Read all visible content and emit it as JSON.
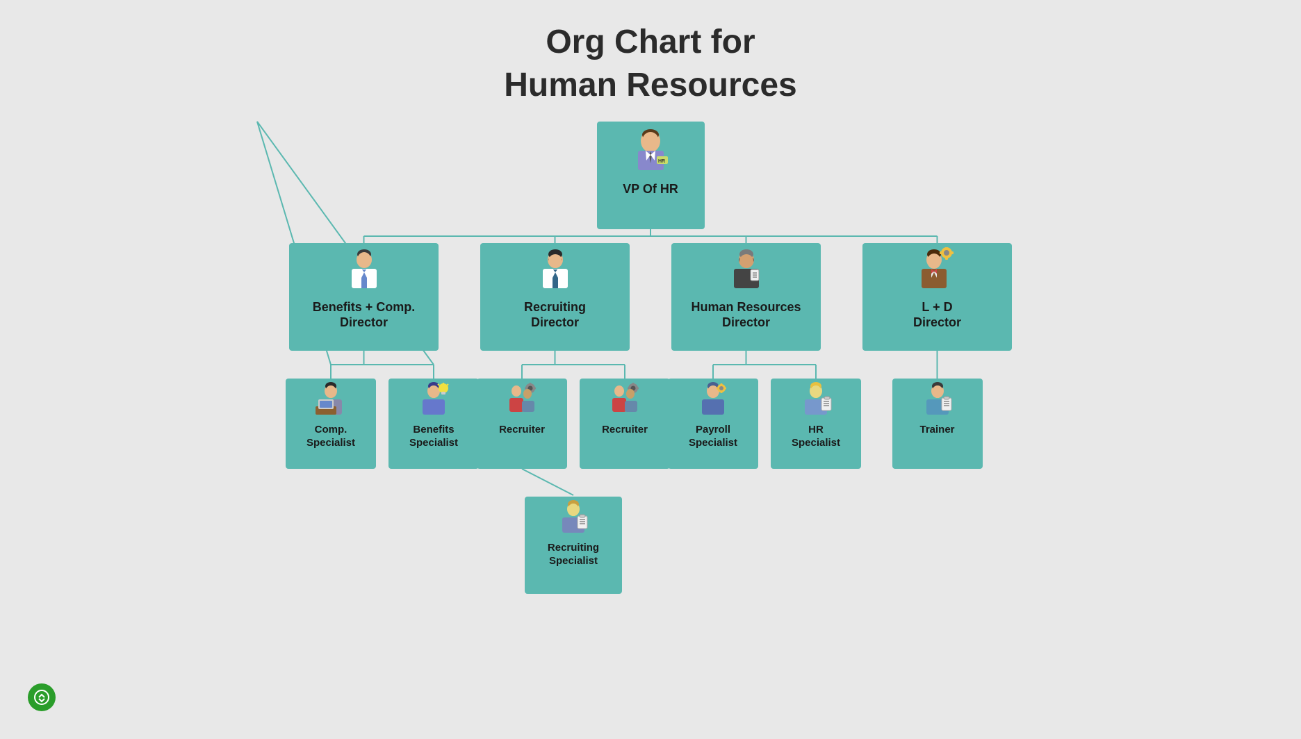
{
  "title": {
    "line1": "Org Chart for",
    "line2": "Human Resources"
  },
  "nodes": {
    "vp": {
      "label": "VP Of HR",
      "icon": "👨‍💼"
    },
    "directors": [
      {
        "id": "benefits-comp",
        "label": "Benefits + Comp.\nDirector",
        "icon": "👨‍💼"
      },
      {
        "id": "recruiting",
        "label": "Recruiting\nDirector",
        "icon": "👨‍💼"
      },
      {
        "id": "hr-director",
        "label": "Human Resources\nDirector",
        "icon": "👨‍💼"
      },
      {
        "id": "ld-director",
        "label": "L + D\nDirector",
        "icon": "👨‍💼"
      }
    ],
    "specialists": {
      "benefits-comp": [
        {
          "id": "comp-specialist",
          "label": "Comp.\nSpecialist",
          "icon": "🧑‍💻"
        },
        {
          "id": "benefits-specialist",
          "label": "Benefits\nSpecialist",
          "icon": "👨‍💼"
        }
      ],
      "recruiting": [
        {
          "id": "recruiter1",
          "label": "Recruiter",
          "icon": "👥"
        },
        {
          "id": "recruiter2",
          "label": "Recruiter",
          "icon": "👥"
        }
      ],
      "hr-director": [
        {
          "id": "payroll-specialist",
          "label": "Payroll\nSpecialist",
          "icon": "🧑‍💼"
        },
        {
          "id": "hr-specialist",
          "label": "HR\nSpecialist",
          "icon": "🧑‍💼"
        }
      ],
      "ld-director": [
        {
          "id": "trainer",
          "label": "Trainer",
          "icon": "🧑‍🏫"
        }
      ]
    },
    "level4": {
      "recruiting-specialist": {
        "label": "Recruiting\nSpecialist",
        "icon": "🧑‍💼",
        "parent": "recruiter1"
      }
    }
  },
  "colors": {
    "node_bg": "#5bb8b0",
    "line_color": "#5bb8b0",
    "bg": "#e8e8e8"
  },
  "logo": "🔄"
}
